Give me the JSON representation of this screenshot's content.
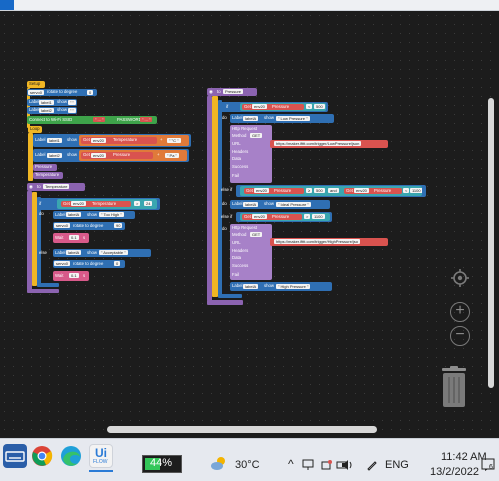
{
  "blocks_setup": {
    "setup": "Setup",
    "servo_rotate": "rotate to degree",
    "servo_name": "servo0",
    "servo_val": "0",
    "label_word": "Label",
    "label1": "label1",
    "label2": "label2",
    "show_word": "show",
    "empty_str": "\" \"",
    "wifi": "Connect to Wi-Fi SSID",
    "wifi_ssid": "\" ... \"",
    "password_word": "PASSWORD",
    "wifi_pass": "\" ... \"",
    "loop": "Loop",
    "get_word": "Get",
    "env_name": "env20",
    "temperature_word": "Temperature",
    "pressure_word": "Pressure",
    "plus": "+",
    "unit_c": "\" °C \"",
    "unit_pa": "\" Pa \"",
    "pressure_call": "Pressure",
    "temperature_call": "Temperature"
  },
  "blocks_temperature": {
    "func_to": "to",
    "func_name": "Temperature",
    "if_word": "if",
    "do_word": "do",
    "else_word": "else",
    "gt": ">",
    "limit": "24",
    "label_name": "labelA",
    "too_high": "\" Too High \"",
    "servo_deg1": "90",
    "wait_word": "Wait",
    "wait_val": "0.1",
    "s": "s",
    "acceptable": "\" Acceptable \"",
    "servo_deg2": "0",
    "wait_val2": "0.1"
  },
  "blocks_pressure": {
    "func_to": "to",
    "func_name": "Pressure",
    "if_word": "if",
    "do_word": "do",
    "else_if": "else if",
    "lt": "<",
    "gt": ">",
    "and_word": "and",
    "lte": "≥",
    "val_500": "500",
    "val_1100": "1100",
    "low_pressure": "\" Low Pressure \"",
    "ideal_pressure": "\" Ideal Pressure \"",
    "high_pressure": "\" High Pressure \"",
    "http_request": "Http Request",
    "method": "Method",
    "method_val": "GET",
    "url": "URL",
    "url_low": "https://maker.ifttt.com/trigger/LowPressure/json",
    "url_high": "https://maker.ifttt.com/trigger/HighPressure/jso",
    "headers": "Headers",
    "data": "Data",
    "success": "Success",
    "fail": "Fail"
  },
  "taskbar": {
    "battery": "44%",
    "temperature": "30°C",
    "lang": "ENG",
    "time": "11:42 AM",
    "date": "13/2/2022",
    "uiflow_line1": "Ui",
    "uiflow_line2": "FLOW",
    "notif_count": "6"
  },
  "colors": {
    "canvas": "#1c1c1c",
    "logic_blue": "#2f6fb3",
    "control_yellow": "#f0b624",
    "function_purple": "#8b63b0",
    "text_red": "#d9534f",
    "battery_green": "#34c759"
  }
}
